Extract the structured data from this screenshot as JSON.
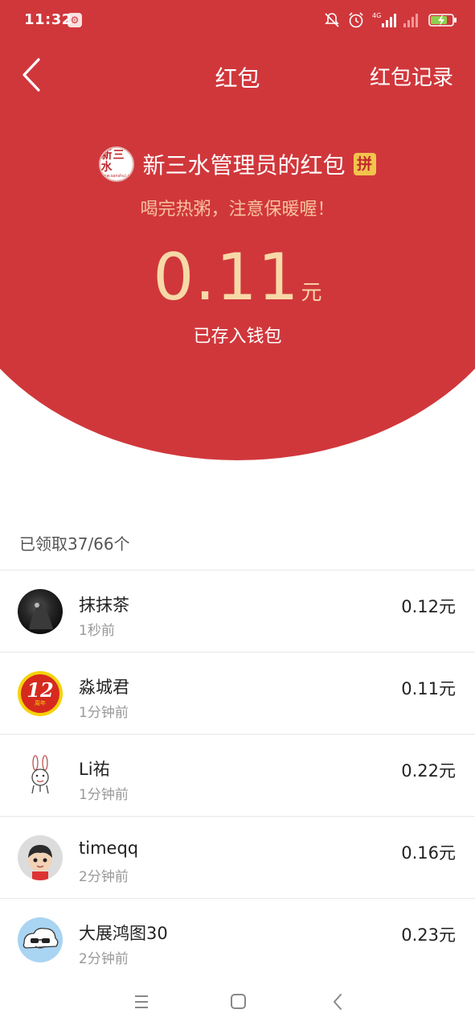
{
  "status_bar": {
    "time": "11:32",
    "network": "4G",
    "icons": [
      "settings-icon",
      "mute-icon",
      "alarm-icon",
      "signal-icon",
      "signal-weak-icon",
      "battery-charging-icon"
    ]
  },
  "header": {
    "title": "红包",
    "record_label": "红包记录"
  },
  "packet": {
    "sender_avatar_text": "新三水",
    "sender_avatar_subtext": "www.sanshui.net",
    "sender_name": "新三水管理员的红包",
    "pin_badge": "拼",
    "greeting": "喝完热粥，注意保暖喔！",
    "amount": "0.11",
    "unit": "元",
    "status": "已存入钱包"
  },
  "claims": {
    "summary": "已领取37/66个",
    "items": [
      {
        "name": "抹抹茶",
        "time": "1秒前",
        "amount": "0.12元"
      },
      {
        "name": "淼城君",
        "time": "1分钟前",
        "amount": "0.11元",
        "avatar_text": "12",
        "avatar_subtext": "周年"
      },
      {
        "name": "Li祐",
        "time": "1分钟前",
        "amount": "0.22元"
      },
      {
        "name": "timeqq",
        "time": "2分钟前",
        "amount": "0.16元"
      },
      {
        "name": "大展鸿图30",
        "time": "2分钟前",
        "amount": "0.23元"
      }
    ]
  },
  "colors": {
    "primary_red": "#d0373b",
    "amount_gold": "#f7d9a8",
    "greeting_gold": "#f7c29d",
    "badge_yellow": "#f3c44d"
  }
}
